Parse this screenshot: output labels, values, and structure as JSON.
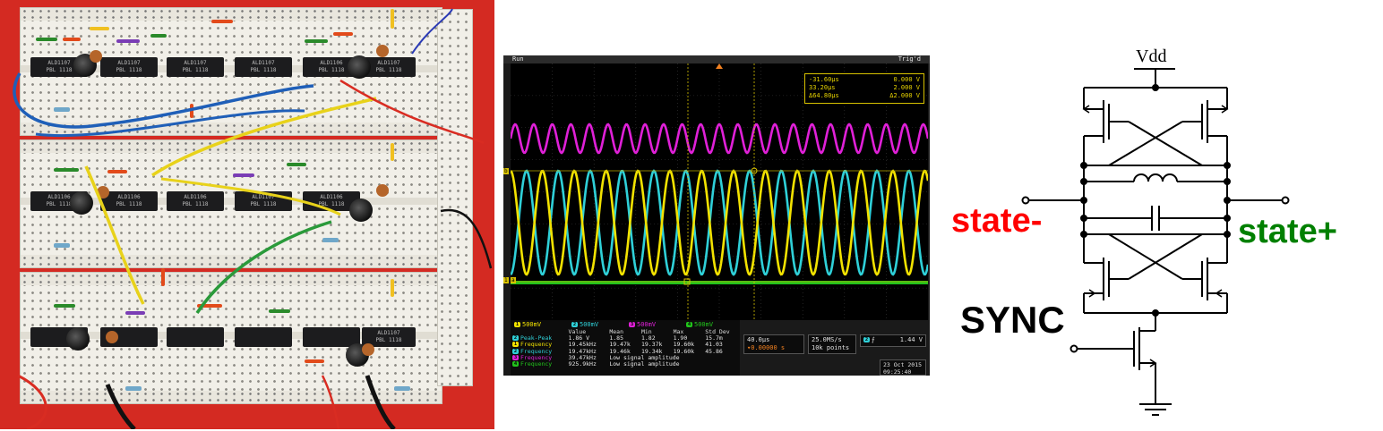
{
  "photo": {
    "chip_labels": [
      "ALD1107\nPBL 1118",
      "ALD1107\nPBL 1118",
      "ALD1107\nPBL 1118",
      "ALD1107\nPBL 1118",
      "ALD1106\nPBL 1118",
      "ALD1107\nPBL 1118",
      "ALD1106\nPBL 1118",
      "ALD1106\nPBL 1118",
      "ALD1106\nPBL 1118",
      "ALD1107\nPBL 1118",
      "ALD1106\nPBL 1118",
      "ALD1107\nPBL 1118"
    ]
  },
  "scope": {
    "status": "Run",
    "trigger_status": "Trig'd",
    "channel_colors": {
      "ch1": "#f2e200",
      "ch2": "#2fd0d8",
      "ch3": "#e020d8",
      "ch4": "#22c41c"
    },
    "cursors": {
      "t1": "-31.60µs",
      "v1": "0.000 V",
      "t2": "33.20µs",
      "v2": "2.000 V",
      "dt": "Δ64.80µs",
      "dv": "Δ2.000 V"
    },
    "channel_scales": [
      {
        "ch": "1",
        "value": "500mV"
      },
      {
        "ch": "2",
        "value": "500mV"
      },
      {
        "ch": "3",
        "value": "500mV"
      },
      {
        "ch": "4",
        "value": "500mV"
      }
    ],
    "measurements": {
      "headers": [
        "",
        "Value",
        "Mean",
        "Min",
        "Max",
        "Std Dev"
      ],
      "rows": [
        {
          "ch": "2",
          "name": "Peak-Peak",
          "cells": [
            "1.86 V",
            "1.85",
            "1.82",
            "1.90",
            "15.7m"
          ]
        },
        {
          "ch": "1",
          "name": "Frequency",
          "cells": [
            "19.45kHz",
            "19.47k",
            "19.37k",
            "19.60k",
            "41.03"
          ]
        },
        {
          "ch": "2",
          "name": "Frequency",
          "cells": [
            "19.47kHz",
            "19.46k",
            "19.34k",
            "19.60k",
            "45.86"
          ]
        },
        {
          "ch": "3",
          "name": "Frequency",
          "cells": [
            "39.47kHz",
            "Low signal amplitude",
            "",
            "",
            ""
          ]
        },
        {
          "ch": "4",
          "name": "Frequency",
          "cells": [
            "925.9kHz",
            "Low signal amplitude",
            "",
            "",
            ""
          ]
        }
      ]
    },
    "horizontal": {
      "scale": "40.0µs",
      "delay": "▾0.00000 s"
    },
    "acquisition": {
      "rate": "25.0MS/s",
      "points": "10k points"
    },
    "trigger": {
      "ch": "2",
      "slope": "⨍",
      "level": "1.44 V"
    },
    "date": "23 Oct  2015",
    "time": "09:25:40",
    "markers": {
      "ref_b": "b",
      "ref_a": "a",
      "ch1": "1"
    }
  },
  "schematic": {
    "vdd_label": "Vdd",
    "state_minus": "state-",
    "state_plus": "state+",
    "sync": "SYNC",
    "colors": {
      "state_minus": "#ff0000",
      "state_plus": "#008000",
      "sync": "#000000"
    }
  }
}
